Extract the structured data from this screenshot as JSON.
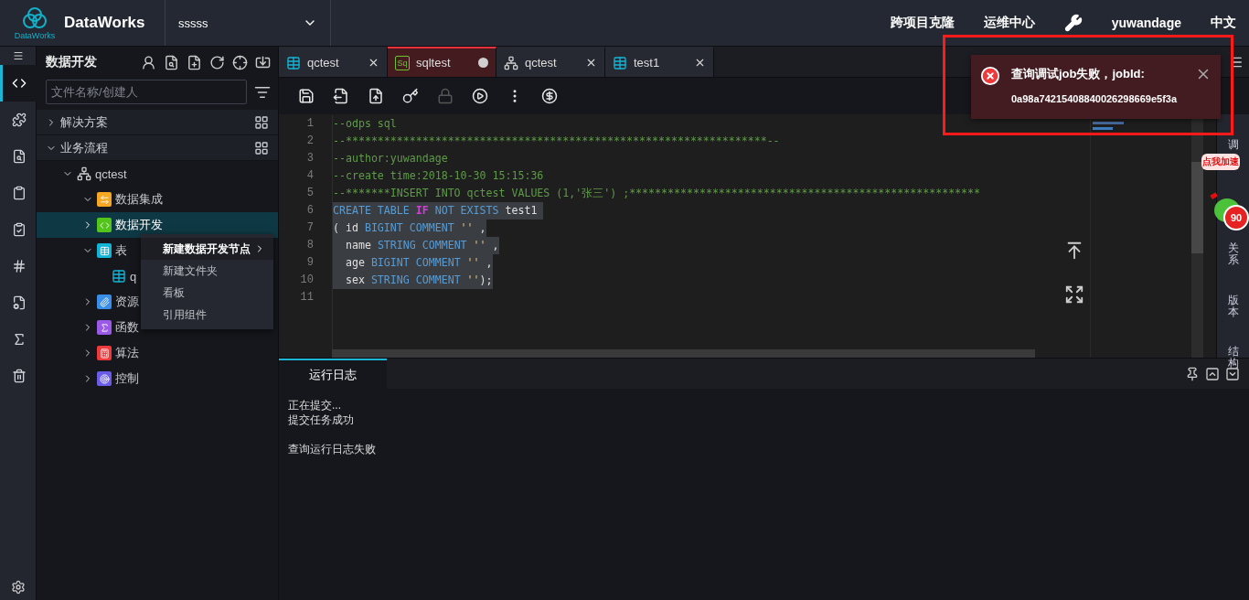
{
  "header": {
    "logo_caption": "DataWorks",
    "brand": "DataWorks",
    "project": "sssss",
    "links": [
      "跨项目克隆",
      "运维中心"
    ],
    "user": "yuwandage",
    "language": "中文"
  },
  "left_nav": [
    {
      "kind": "code",
      "selected": true
    },
    {
      "kind": "puzzle",
      "selected": false
    },
    {
      "kind": "search-doc",
      "selected": false
    },
    {
      "kind": "clipboard",
      "selected": false
    },
    {
      "kind": "clipboard-check",
      "selected": false
    },
    {
      "kind": "hash",
      "selected": false
    },
    {
      "kind": "doc-gear",
      "selected": false
    },
    {
      "kind": "function",
      "selected": false
    },
    {
      "kind": "trash",
      "selected": false
    }
  ],
  "sidebar": {
    "title": "数据开发",
    "search": {
      "placeholder": "文件名称/创建人"
    },
    "items": [
      {
        "label": "解决方案",
        "expanded": false,
        "selected": false
      },
      {
        "label": "业务流程",
        "expanded": true,
        "selected": false,
        "children": [
          {
            "label": "qctest",
            "kind": "flow",
            "expanded": true,
            "selected": false,
            "children": [
              {
                "label": "数据集成",
                "kind": "integration",
                "color": "#f5a623",
                "expanded": true,
                "selected": false
              },
              {
                "label": "数据开发",
                "kind": "code",
                "color": "#52c41a",
                "expanded": false,
                "selected": true
              },
              {
                "label": "表",
                "kind": "table",
                "color": "#13b5d6",
                "expanded": true,
                "selected": false,
                "children": [
                  {
                    "label": "q",
                    "kind": "table-file",
                    "selected": false
                  }
                ]
              },
              {
                "label": "资源",
                "kind": "resource",
                "color": "#3b8ee8",
                "expanded": false,
                "selected": false
              },
              {
                "label": "函数",
                "kind": "function",
                "color": "#9b59e8",
                "expanded": false,
                "selected": false
              },
              {
                "label": "算法",
                "kind": "algorithm",
                "color": "#f0393b",
                "expanded": false,
                "selected": false
              },
              {
                "label": "控制",
                "kind": "control",
                "color": "#6a5ce8",
                "expanded": false,
                "selected": false
              }
            ]
          }
        ]
      }
    ]
  },
  "context_menu": [
    {
      "label": "新建数据开发节点",
      "submenu": true,
      "selected": true
    },
    {
      "label": "新建文件夹",
      "submenu": false,
      "selected": false
    },
    {
      "label": "看板",
      "submenu": false,
      "selected": false
    },
    {
      "label": "引用组件",
      "submenu": false,
      "selected": false
    }
  ],
  "tabs": [
    {
      "label": "qctest",
      "kind": "table",
      "selected": false,
      "modified": false
    },
    {
      "label": "sqltest",
      "kind": "sql",
      "icon_text": "Sq",
      "selected": true,
      "modified": true
    },
    {
      "label": "qctest",
      "kind": "flow",
      "selected": false,
      "modified": false
    },
    {
      "label": "test1",
      "kind": "table",
      "selected": false,
      "modified": false
    }
  ],
  "toolbar": [
    {
      "kind": "save",
      "disabled": false
    },
    {
      "kind": "save-as",
      "disabled": false
    },
    {
      "kind": "submit",
      "disabled": false
    },
    {
      "kind": "key",
      "disabled": false
    },
    {
      "kind": "lock",
      "disabled": true
    },
    {
      "kind": "run",
      "disabled": false
    },
    {
      "kind": "more",
      "disabled": false
    },
    {
      "kind": "cost",
      "disabled": false
    }
  ],
  "editor": {
    "lines": [
      {
        "number": "1",
        "selected": false,
        "tokens": [
          {
            "kind": "comment",
            "text": "--odps sql"
          }
        ]
      },
      {
        "number": "2",
        "selected": false,
        "tokens": [
          {
            "kind": "comment",
            "text": "--******************************************************************--"
          }
        ]
      },
      {
        "number": "3",
        "selected": false,
        "tokens": [
          {
            "kind": "comment",
            "text": "--author:yuwandage"
          }
        ]
      },
      {
        "number": "4",
        "selected": false,
        "tokens": [
          {
            "kind": "comment",
            "text": "--create time:2018-10-30 15:15:36"
          }
        ]
      },
      {
        "number": "5",
        "selected": false,
        "tokens": [
          {
            "kind": "comment",
            "text": "--*******INSERT INTO qctest VALUES (1,'张三') ;*******************************************************"
          }
        ]
      },
      {
        "number": "6",
        "selected": true,
        "tokens": [
          {
            "kind": "keyword",
            "text": "CREATE TABLE "
          },
          {
            "kind": "control",
            "text": "IF"
          },
          {
            "kind": "keyword",
            "text": " NOT EXISTS"
          },
          {
            "kind": "plain",
            "text": " test1 "
          }
        ]
      },
      {
        "number": "7",
        "selected": true,
        "tokens": [
          {
            "kind": "plain",
            "text": "( id "
          },
          {
            "kind": "keyword",
            "text": "BIGINT COMMENT "
          },
          {
            "kind": "string",
            "text": "''"
          },
          {
            "kind": "plain",
            "text": " ,"
          }
        ]
      },
      {
        "number": "8",
        "selected": true,
        "tokens": [
          {
            "kind": "plain",
            "text": "  name "
          },
          {
            "kind": "keyword",
            "text": "STRING COMMENT "
          },
          {
            "kind": "string",
            "text": "''"
          },
          {
            "kind": "plain",
            "text": " ,"
          }
        ]
      },
      {
        "number": "9",
        "selected": true,
        "tokens": [
          {
            "kind": "plain",
            "text": "  age "
          },
          {
            "kind": "keyword",
            "text": "BIGINT COMMENT "
          },
          {
            "kind": "string",
            "text": "''"
          },
          {
            "kind": "plain",
            "text": " ,"
          }
        ]
      },
      {
        "number": "10",
        "selected": true,
        "tokens": [
          {
            "kind": "plain",
            "text": "  sex "
          },
          {
            "kind": "keyword",
            "text": "STRING COMMENT "
          },
          {
            "kind": "string",
            "text": "''"
          },
          {
            "kind": "plain",
            "text": ");"
          }
        ]
      },
      {
        "number": "11",
        "selected": false
      }
    ]
  },
  "right_tabs": [
    "调",
    "关系",
    "版本",
    "结构"
  ],
  "speed_widget": {
    "bubble": "点我加速",
    "score": "90"
  },
  "bottom_panel": {
    "tabs": [
      {
        "label": "运行日志",
        "selected": true
      }
    ],
    "log_paragraphs": [
      [
        "正在提交...",
        "提交任务成功"
      ],
      [
        "查询运行日志失败"
      ]
    ]
  },
  "toast": {
    "kind": "error",
    "title": "查询调试job失败，jobId:",
    "detail": "0a98a74215408840026298669e5f3a",
    "highlighted": true
  }
}
